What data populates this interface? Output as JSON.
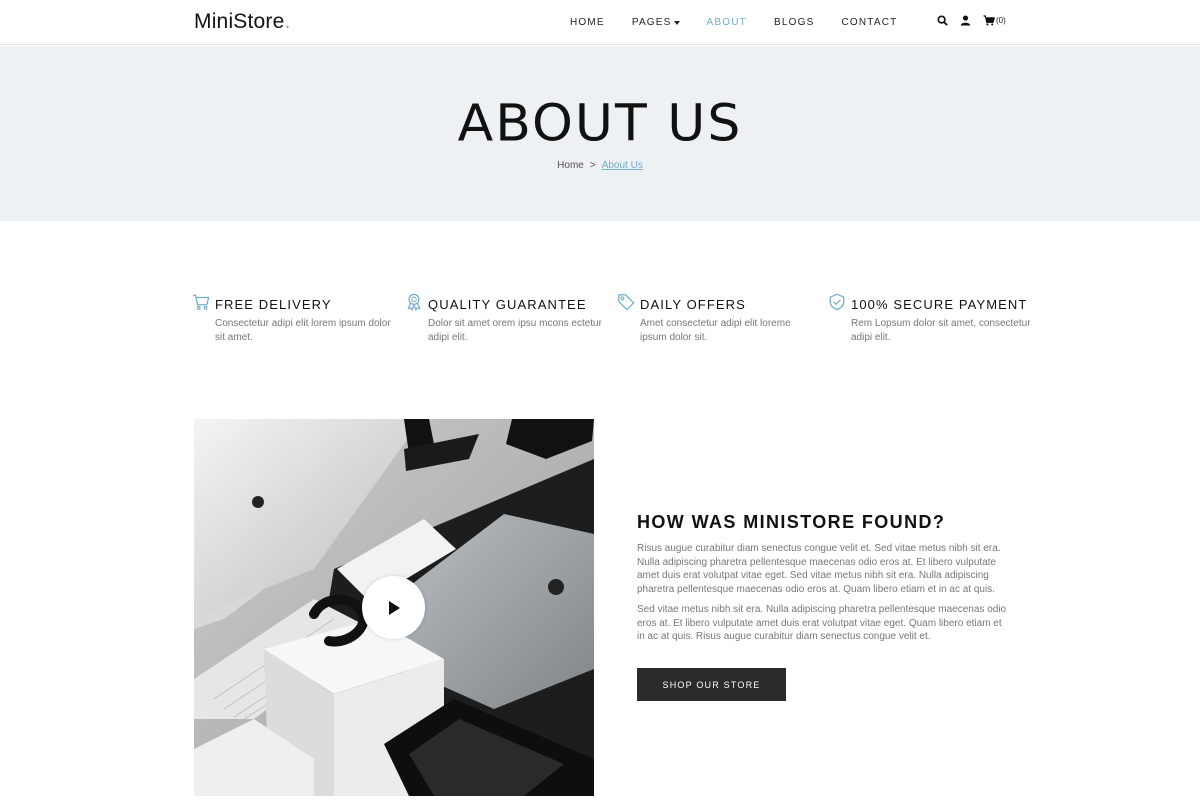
{
  "header": {
    "logo": "MiniStore",
    "logo_dot": ".",
    "nav": [
      {
        "label": "HOME"
      },
      {
        "label": "PAGES"
      },
      {
        "label": "ABOUT"
      },
      {
        "label": "BLOGS"
      },
      {
        "label": "CONTACT"
      }
    ],
    "active_nav": "ABOUT",
    "icons": [
      "search-icon",
      "user-icon",
      "cart-icon"
    ],
    "cart_count": "(0)"
  },
  "hero": {
    "title": "ABOUT US",
    "breadcrumb": {
      "home": "Home",
      "separator": ">",
      "current": "About Us"
    }
  },
  "features": [
    {
      "icon": "cart-icon",
      "title": "FREE DELIVERY",
      "text": "Consectetur adipi elit lorem ipsum dolor sit amet."
    },
    {
      "icon": "award-icon",
      "title": "QUALITY GUARANTEE",
      "text": "Dolor sit amet orem ipsu mcons ectetur adipi elit."
    },
    {
      "icon": "tag-icon",
      "title": "DAILY OFFERS",
      "text": "Amet consectetur adipi elit loreme ipsum dolor sit."
    },
    {
      "icon": "shield-check-icon",
      "title": "100% SECURE PAYMENT",
      "text": "Rem Lopsum dolor sit amet, consectetur adipi elit."
    }
  ],
  "media": {
    "play_icon": "play-icon"
  },
  "story": {
    "title": "HOW WAS MINISTORE FOUND?",
    "paragraph1": "Risus augue curabitur diam senectus congue velit et. Sed vitae metus nibh sit era. Nulla adipiscing pharetra pellentesque maecenas odio eros at. Et libero vulputate amet duis erat volutpat vitae eget. Sed vitae metus nibh sit era. Nulla adipiscing pharetra pellentesque maecenas odio eros at. Quam libero etiam et in ac at quis.",
    "paragraph2": "Sed vitae metus nibh sit era. Nulla adipiscing pharetra pellentesque maecenas odio eros at. Et libero vulputate amet duis erat volutpat vitae eget. Quam libero etiam et in ac at quis. Risus augue curabitur diam senectus congue velit et.",
    "button": "SHOP OUR STORE"
  },
  "colors": {
    "accent": "#72aec8",
    "hero_bg": "#edf1f4",
    "button_bg": "#2b2b2b"
  }
}
